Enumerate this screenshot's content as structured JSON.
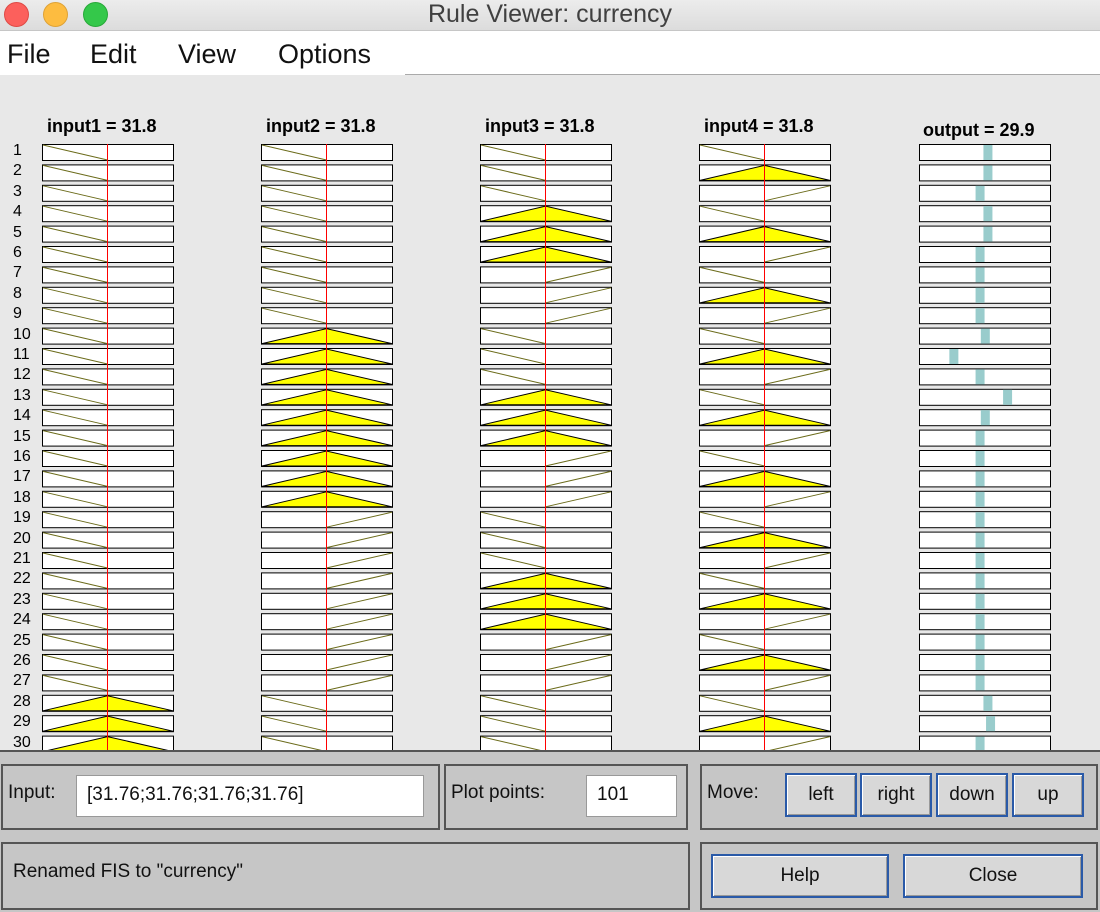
{
  "window": {
    "title": "Rule Viewer: currency"
  },
  "menu": [
    "File",
    "Edit",
    "View",
    "Options"
  ],
  "columns": [
    {
      "title": "input1 = 31.8"
    },
    {
      "title": "input2 = 31.8"
    },
    {
      "title": "input3 = 31.8"
    },
    {
      "title": "input4 = 31.8"
    }
  ],
  "output": {
    "title": "output = 29.9"
  },
  "input_value": 31.76,
  "rule_numbers": [
    "1",
    "2",
    "3",
    "4",
    "5",
    "6",
    "7",
    "8",
    "9",
    "10",
    "11",
    "12",
    "13",
    "14",
    "15",
    "16",
    "17",
    "18",
    "19",
    "20",
    "21",
    "22",
    "23",
    "24",
    "25",
    "26",
    "27",
    "28",
    "29",
    "30"
  ],
  "rules": [
    {
      "in": [
        "L",
        "L",
        "L",
        "L"
      ],
      "out": 0.53
    },
    {
      "in": [
        "L",
        "L",
        "L",
        "M"
      ],
      "out": 0.53
    },
    {
      "in": [
        "L",
        "L",
        "L",
        "H"
      ],
      "out": 0.47
    },
    {
      "in": [
        "L",
        "L",
        "M",
        "L"
      ],
      "out": 0.53
    },
    {
      "in": [
        "L",
        "L",
        "M",
        "M"
      ],
      "out": 0.53
    },
    {
      "in": [
        "L",
        "L",
        "M",
        "H"
      ],
      "out": 0.47
    },
    {
      "in": [
        "L",
        "L",
        "H",
        "L"
      ],
      "out": 0.47
    },
    {
      "in": [
        "L",
        "L",
        "H",
        "M"
      ],
      "out": 0.47
    },
    {
      "in": [
        "L",
        "L",
        "H",
        "H"
      ],
      "out": 0.47
    },
    {
      "in": [
        "L",
        "M",
        "L",
        "L"
      ],
      "out": 0.51
    },
    {
      "in": [
        "L",
        "M",
        "L",
        "M"
      ],
      "out": 0.27
    },
    {
      "in": [
        "L",
        "M",
        "L",
        "H"
      ],
      "out": 0.47
    },
    {
      "in": [
        "L",
        "M",
        "M",
        "L"
      ],
      "out": 0.68
    },
    {
      "in": [
        "L",
        "M",
        "M",
        "M"
      ],
      "out": 0.51
    },
    {
      "in": [
        "L",
        "M",
        "M",
        "H"
      ],
      "out": 0.47
    },
    {
      "in": [
        "L",
        "M",
        "H",
        "L"
      ],
      "out": 0.47
    },
    {
      "in": [
        "L",
        "M",
        "H",
        "M"
      ],
      "out": 0.47
    },
    {
      "in": [
        "L",
        "M",
        "H",
        "H"
      ],
      "out": 0.47
    },
    {
      "in": [
        "L",
        "H",
        "L",
        "L"
      ],
      "out": 0.47
    },
    {
      "in": [
        "L",
        "H",
        "L",
        "M"
      ],
      "out": 0.47
    },
    {
      "in": [
        "L",
        "H",
        "L",
        "H"
      ],
      "out": 0.47
    },
    {
      "in": [
        "L",
        "H",
        "M",
        "L"
      ],
      "out": 0.47
    },
    {
      "in": [
        "L",
        "H",
        "M",
        "M"
      ],
      "out": 0.47
    },
    {
      "in": [
        "L",
        "H",
        "M",
        "H"
      ],
      "out": 0.47
    },
    {
      "in": [
        "L",
        "H",
        "H",
        "L"
      ],
      "out": 0.47
    },
    {
      "in": [
        "L",
        "H",
        "H",
        "M"
      ],
      "out": 0.47
    },
    {
      "in": [
        "L",
        "H",
        "H",
        "H"
      ],
      "out": 0.47
    },
    {
      "in": [
        "M",
        "L",
        "L",
        "L"
      ],
      "out": 0.53
    },
    {
      "in": [
        "M",
        "L",
        "L",
        "M"
      ],
      "out": 0.55
    },
    {
      "in": [
        "M",
        "L",
        "L",
        "H"
      ],
      "out": 0.47
    }
  ],
  "colors": {
    "mf_fill": "#ffff00",
    "mf_line": "#6b6b1a",
    "cursor": "#ff0000",
    "output_bar": "#99cccc"
  },
  "input": {
    "label": "Input:",
    "value": "[31.76;31.76;31.76;31.76]"
  },
  "plot_points": {
    "label": "Plot points:",
    "value": "101"
  },
  "move": {
    "label": "Move:",
    "buttons": [
      "left",
      "right",
      "down",
      "up"
    ]
  },
  "status": "Renamed FIS to \"currency\"",
  "buttons": {
    "help": "Help",
    "close": "Close"
  }
}
